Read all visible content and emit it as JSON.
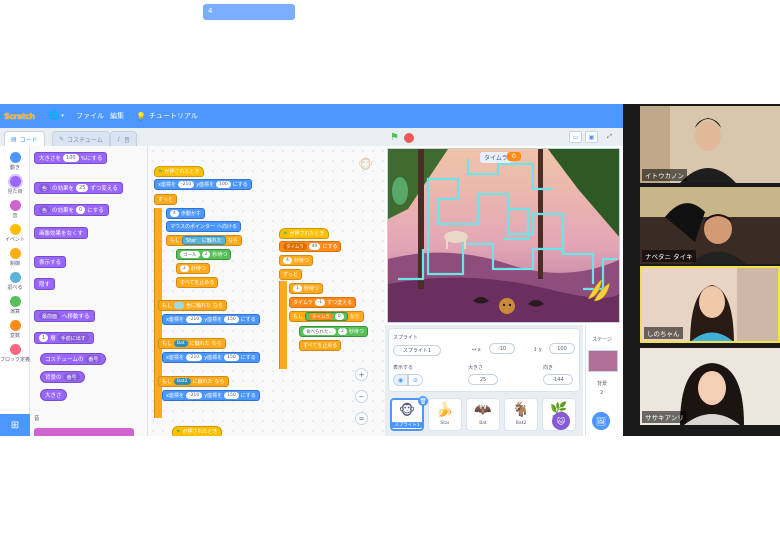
{
  "menubar": {
    "logo": "Scratch",
    "file_label": "ファイル",
    "edit_label": "編集",
    "tutorials_label": "チュートリアル",
    "project_title": "4",
    "color": "#4c97ff"
  },
  "tabs": [
    {
      "label": "コード",
      "icon": "code-icon",
      "active": true
    },
    {
      "label": "コスチューム",
      "icon": "brush-icon",
      "active": false
    },
    {
      "label": "音",
      "icon": "speaker-icon",
      "active": false
    }
  ],
  "categories": [
    {
      "label": "動き",
      "color": "#4c97ff"
    },
    {
      "label": "見た目",
      "color": "#9966ff"
    },
    {
      "label": "音",
      "color": "#cf63cf"
    },
    {
      "label": "イベント",
      "color": "#ffbf00"
    },
    {
      "label": "制御",
      "color": "#ffab19"
    },
    {
      "label": "調べる",
      "color": "#5cb1d6"
    },
    {
      "label": "演算",
      "color": "#59c059"
    },
    {
      "label": "変数",
      "color": "#ff8c1a"
    },
    {
      "label": "ブロック定義",
      "color": "#ff6680"
    }
  ],
  "palette": {
    "size_label": "大きさを",
    "size_value": "100",
    "size_suffix": "%にする",
    "effect_change_pre": "色",
    "effect_change_mid": "の効果を",
    "effect_change_value": "25",
    "effect_change_suffix": "ずつ変える",
    "effect_set_pre": "色",
    "effect_set_mid": "の効果を",
    "effect_set_value": "0",
    "effect_set_suffix": "にする",
    "clear_effects": "画像効果をなくす",
    "show": "表示する",
    "hide": "隠す",
    "front_pre": "最前面",
    "front_suffix": "へ移動する",
    "layer_value": "1",
    "layer_mid": "層",
    "layer_dir": "手前に出す",
    "costume_pre": "コスチュームの",
    "costume_dd": "番号",
    "backdrop_pre": "背景の",
    "backdrop_dd": "番号",
    "size_reporter": "大きさ",
    "sound_heading": "音"
  },
  "code": {
    "hat1": "が押されたとき",
    "goto1_x_label": "x座標を",
    "goto1_x": "-210",
    "goto1_y_label": "y座標を",
    "goto1_y": "100",
    "goto1_suffix": "にする",
    "forever1": "ずっと",
    "move_value": "4",
    "move_suffix": "歩動かす",
    "point_towards": "マウスのポインター",
    "point_suffix": "へ向ける",
    "if_star_dd": "Star",
    "if_touch": "に触れた",
    "then": "なら",
    "goal_dd": "ゴール",
    "goal_value": "2",
    "goal_suffix": "秒待つ",
    "wait_value": "2",
    "wait_suffix": "秒待つ",
    "stop_all": "すべてを止める",
    "if_color": "色に触れた",
    "reset_x": "-210",
    "reset_y": "150",
    "bat_dd": "Bat",
    "bat2_dd": "Bat2",
    "if_label": "もし",
    "hat3": "が押されたとき",
    "hat2": "が押されたとき",
    "timer_set": "タイムラ",
    "timer_set_value": "40",
    "timer_set_suffix": "にする",
    "wait1_value": "4",
    "wait1_suffix": "秒待つ",
    "forever2": "ずっと",
    "wait2_value": "1",
    "wait2_suffix": "秒待つ",
    "timer_change": "タイムラ",
    "timer_change_value": "-1",
    "timer_change_suffix": "ずつ変える",
    "timer_eq_value": "0",
    "eat_label": "食べられた…",
    "eat_value": "2",
    "eat_suffix": "秒待つ",
    "stop_all_2": "すべてを止める",
    "zoom_in": "+",
    "zoom_out": "−",
    "zoom_reset": "="
  },
  "stage": {
    "timer_label": "タイムラ",
    "timer_value": "0"
  },
  "sprite_info": {
    "sprite_label": "スプライト",
    "sprite_name": "スプライト1",
    "x_label": "x",
    "x_value": "-10",
    "y_label": "y",
    "y_value": "100",
    "show_label": "表示する",
    "size_label": "大きさ",
    "size_value": "25",
    "direction_label": "向き",
    "direction_value": "-144"
  },
  "sprites": [
    {
      "name": "スプライト1",
      "icon": "monkey-icon",
      "selected": true
    },
    {
      "name": "Star",
      "icon": "banana-icon",
      "selected": false
    },
    {
      "name": "Bat",
      "icon": "bat-icon",
      "selected": false
    },
    {
      "name": "Bat2",
      "icon": "bat2-icon",
      "selected": false
    },
    {
      "name": "",
      "icon": "plant-icon",
      "selected": false
    }
  ],
  "stage_selector": {
    "title": "ステージ",
    "backdrop_label": "背景",
    "backdrop_count": "2"
  },
  "participants": [
    {
      "name": "イトウカノン"
    },
    {
      "name": "ナベタニ タイキ"
    },
    {
      "name": "しのちゃん",
      "speaking": true
    },
    {
      "name": "ササキアンリ"
    }
  ]
}
